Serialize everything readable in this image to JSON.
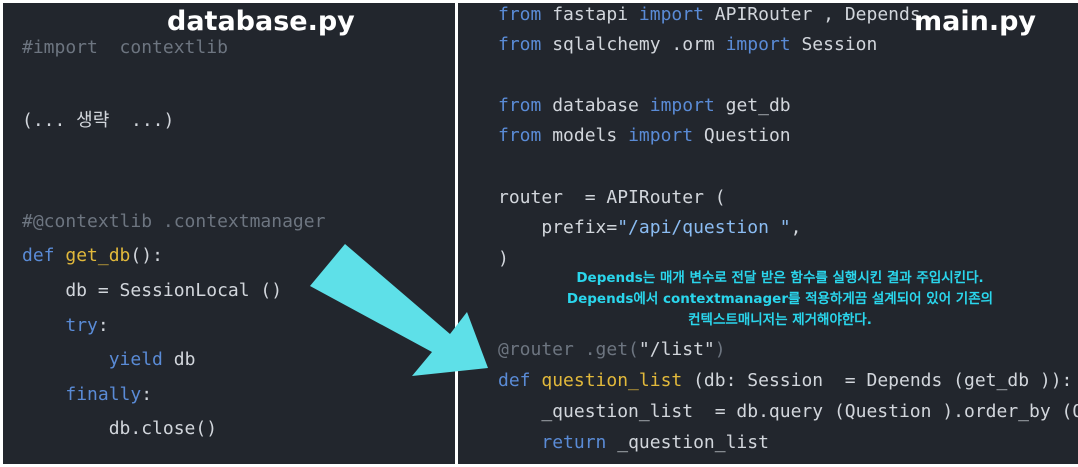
{
  "left_panel": {
    "title": "database.py",
    "lines": [
      {
        "segments": [
          {
            "text": "#import  contextlib",
            "kind": "cm"
          }
        ]
      },
      {
        "segments": [
          {
            "text": "(... 생략  ...)",
            "kind": "tx"
          }
        ]
      },
      {
        "segments": [
          {
            "text": "#@contextlib .contextmanager",
            "kind": "cm"
          }
        ]
      },
      {
        "segments": [
          {
            "text": "def ",
            "kind": "kw"
          },
          {
            "text": "get_db",
            "kind": "fn"
          },
          {
            "text": "():",
            "kind": "tx"
          }
        ]
      },
      {
        "segments": [
          {
            "text": "    db = SessionLocal ()",
            "kind": "tx"
          }
        ]
      },
      {
        "segments": [
          {
            "text": "    ",
            "kind": "tx"
          },
          {
            "text": "try",
            "kind": "kw"
          },
          {
            "text": ":",
            "kind": "tx"
          }
        ]
      },
      {
        "segments": [
          {
            "text": "        ",
            "kind": "tx"
          },
          {
            "text": "yield",
            "kind": "kw"
          },
          {
            "text": " db",
            "kind": "tx"
          }
        ]
      },
      {
        "segments": [
          {
            "text": "    ",
            "kind": "tx"
          },
          {
            "text": "finally",
            "kind": "kw"
          },
          {
            "text": ":",
            "kind": "tx"
          }
        ]
      },
      {
        "segments": [
          {
            "text": "        db.close()",
            "kind": "tx"
          }
        ]
      }
    ]
  },
  "right_panel": {
    "title": "main.py",
    "lines": [
      {
        "segments": [
          {
            "text": "from",
            "kind": "kw"
          },
          {
            "text": " fastapi ",
            "kind": "tx"
          },
          {
            "text": "import",
            "kind": "kw"
          },
          {
            "text": " APIRouter , Depends",
            "kind": "tx"
          }
        ]
      },
      {
        "segments": [
          {
            "text": "from",
            "kind": "kw"
          },
          {
            "text": " sqlalchemy .orm ",
            "kind": "tx"
          },
          {
            "text": "import",
            "kind": "kw"
          },
          {
            "text": " Session",
            "kind": "tx"
          }
        ]
      },
      {
        "segments": [
          {
            "text": "from",
            "kind": "kw"
          },
          {
            "text": " database ",
            "kind": "tx"
          },
          {
            "text": "import",
            "kind": "kw"
          },
          {
            "text": " get_db",
            "kind": "tx"
          }
        ]
      },
      {
        "segments": [
          {
            "text": "from",
            "kind": "kw"
          },
          {
            "text": " models ",
            "kind": "tx"
          },
          {
            "text": "import",
            "kind": "kw"
          },
          {
            "text": " Question",
            "kind": "tx"
          }
        ]
      },
      {
        "segments": [
          {
            "text": "router  = APIRouter (",
            "kind": "tx"
          }
        ]
      },
      {
        "segments": [
          {
            "text": "    prefix=",
            "kind": "tx"
          },
          {
            "text": "\"/api/question \"",
            "kind": "str"
          },
          {
            "text": ",",
            "kind": "tx"
          }
        ]
      },
      {
        "segments": [
          {
            "text": ")",
            "kind": "tx"
          }
        ]
      },
      {
        "segments": [
          {
            "text": "@router .get(",
            "kind": "dec"
          },
          {
            "text": "\"/list\"",
            "kind": "tx"
          },
          {
            "text": ")",
            "kind": "dec"
          }
        ]
      },
      {
        "segments": [
          {
            "text": "def ",
            "kind": "kw"
          },
          {
            "text": "question_list",
            "kind": "fn"
          },
          {
            "text": " (db: Session  = Depends (get_db )):",
            "kind": "tx"
          }
        ]
      },
      {
        "segments": [
          {
            "text": "    _question_list  = db.query (Question ).order_by (Question",
            "kind": "tx"
          }
        ]
      },
      {
        "segments": [
          {
            "text": "    ",
            "kind": "tx"
          },
          {
            "text": "return",
            "kind": "kw"
          },
          {
            "text": " _question_list",
            "kind": "tx"
          }
        ]
      }
    ]
  },
  "annotation": {
    "lines": [
      "Depends는 매개 변수로 전달 받은 함수를 실행시킨 결과 주입시킨다.",
      "Depends에서 contextmanager를 적용하게끔 설계되어 있어 기존의",
      "컨텍스트매니저는 제거해야한다."
    ]
  },
  "colors": {
    "panel_bg": "#22262d",
    "keyword": "#5a8bd6",
    "function": "#e2b93b",
    "string": "#8bbcf2",
    "comment": "#6d7580",
    "text": "#d2d6dc",
    "arrow": "#5ee0e8",
    "annotation": "#2ad6ec"
  }
}
